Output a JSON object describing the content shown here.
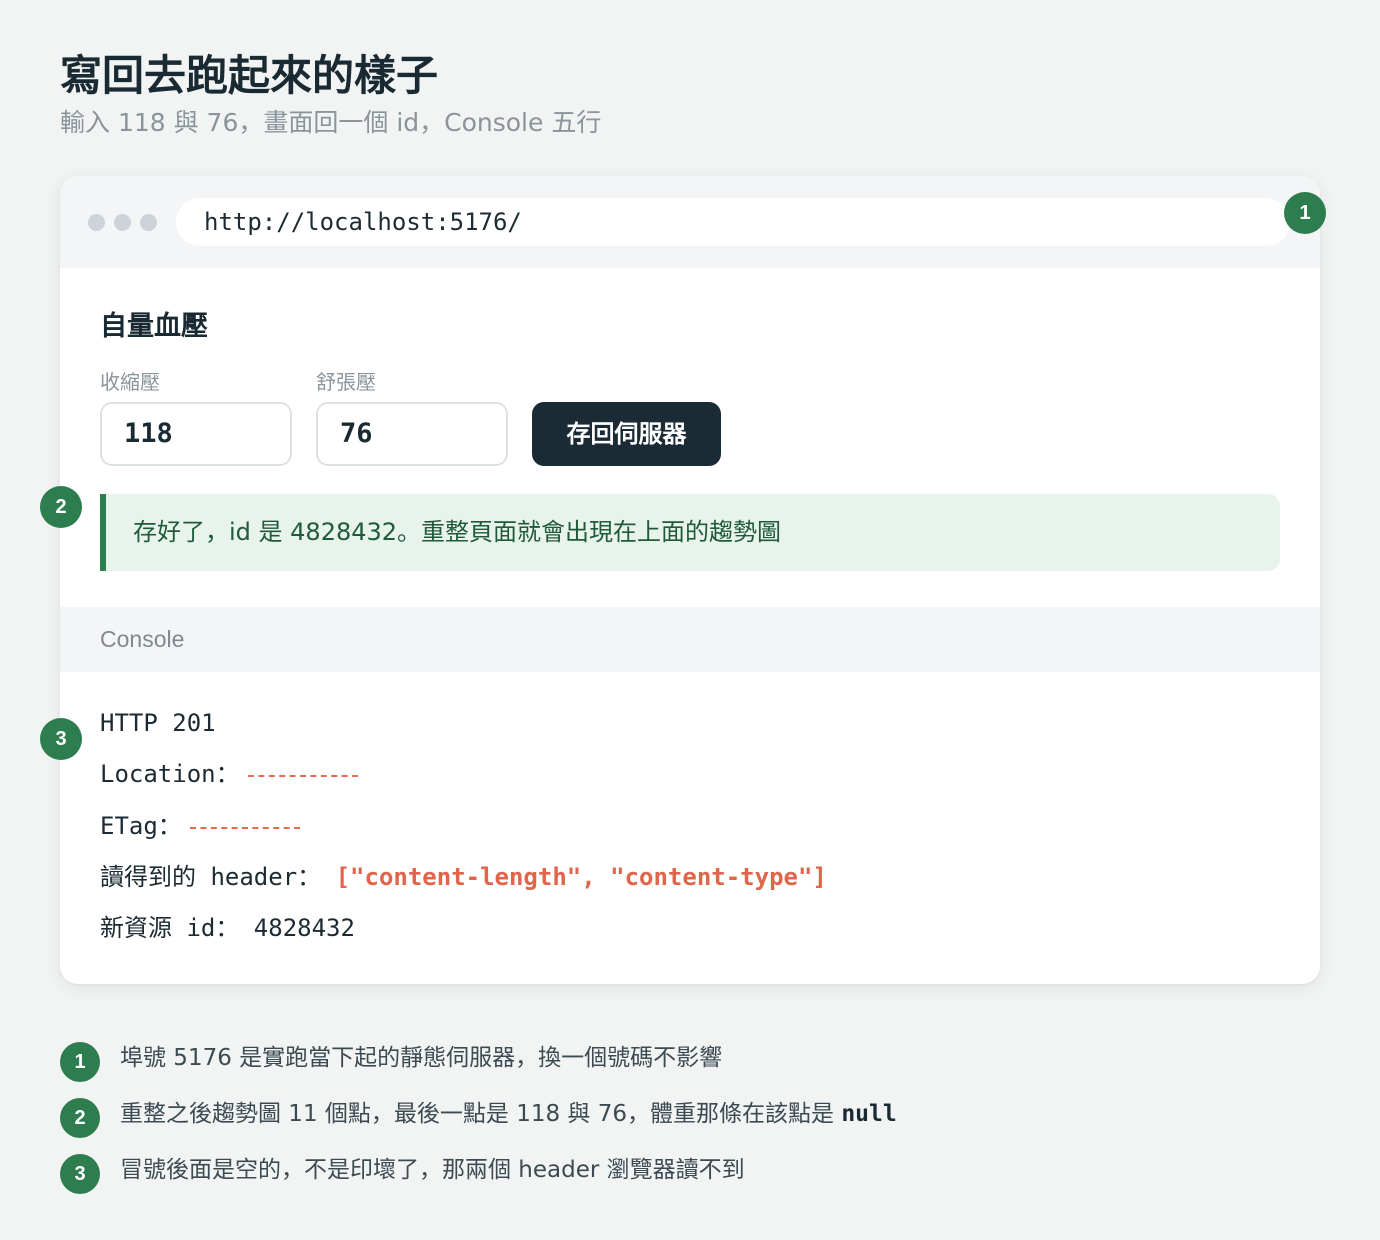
{
  "page": {
    "title": "寫回去跑起來的樣子",
    "subtitle": "輸入 118 與 76，畫面回一個 id，Console 五行"
  },
  "browser": {
    "url": "http://localhost:5176/"
  },
  "form": {
    "title": "自量血壓",
    "systolic_label": "收縮壓",
    "systolic_value": "118",
    "diastolic_label": "舒張壓",
    "diastolic_value": "76",
    "save_label": "存回伺服器",
    "success_message": "存好了，id 是 4828432。重整頁面就會出現在上面的趨勢圖"
  },
  "console": {
    "header": "Console",
    "status_line": "HTTP 201",
    "location_label": "Location：",
    "etag_label": "ETag：",
    "headers_label": "讀得到的 header： ",
    "headers_value": "[\"content-length\", \"content-type\"]",
    "id_label": "新資源 id： ",
    "id_value": "4828432"
  },
  "badges": [
    "1",
    "2",
    "3"
  ],
  "notes": {
    "n1": "埠號 5176 是實跑當下起的靜態伺服器，換一個號碼不影響",
    "n2_text": "重整之後趨勢圖 11 個點，最後一點是 118 與 76，體重那條在該點是 ",
    "n2_code": "null",
    "n3": "冒號後面是空的，不是印壞了，那兩個 header 瀏覽器讀不到"
  },
  "colors": {
    "accent_green": "#2e7d4f",
    "button_dark": "#1a2b36",
    "redacted_red": "#e0654a"
  }
}
